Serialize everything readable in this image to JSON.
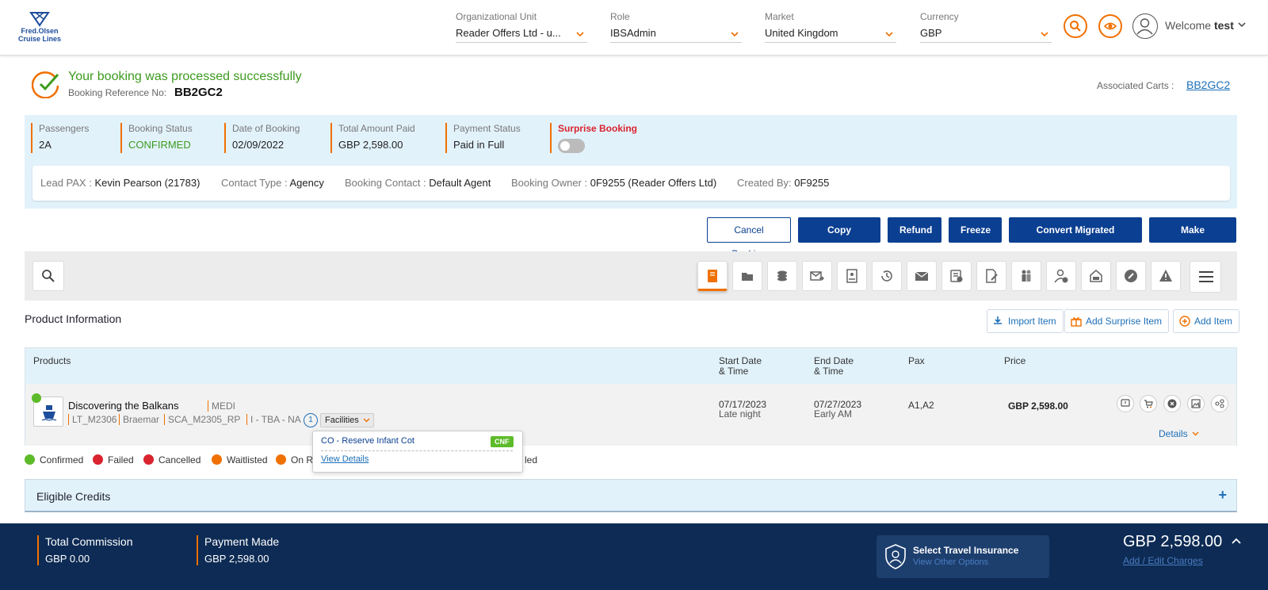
{
  "brand": {
    "line1": "Fred.Olsen",
    "line2": "Cruise Lines"
  },
  "header": {
    "org_unit": {
      "label": "Organizational Unit",
      "value": "Reader Offers Ltd - u..."
    },
    "role": {
      "label": "Role",
      "value": "IBSAdmin"
    },
    "market": {
      "label": "Market",
      "value": "United Kingdom"
    },
    "currency": {
      "label": "Currency",
      "value": "GBP"
    },
    "welcome_prefix": "Welcome",
    "welcome_user": "test"
  },
  "booking": {
    "success_message": "Your booking was processed successfully",
    "ref_label": "Booking Reference No:",
    "ref_value": "BB2GC2",
    "assoc_label": "Associated Carts :",
    "assoc_value": "BB2GC2"
  },
  "summary": {
    "passengers": {
      "label": "Passengers",
      "value": "2A"
    },
    "status": {
      "label": "Booking Status",
      "value": "CONFIRMED"
    },
    "date": {
      "label": "Date of Booking",
      "value": "02/09/2022"
    },
    "paid": {
      "label": "Total Amount Paid",
      "value": "GBP 2,598.00"
    },
    "payment_status": {
      "label": "Payment Status",
      "value": "Paid in Full"
    },
    "surprise": {
      "label": "Surprise Booking",
      "enabled": false
    }
  },
  "contact": {
    "lead_pax": {
      "label": "Lead PAX :",
      "value": "Kevin Pearson (21783)"
    },
    "contact_type": {
      "label": "Contact Type :",
      "value": "Agency"
    },
    "booking_contact": {
      "label": "Booking Contact :",
      "value": "Default Agent"
    },
    "booking_owner": {
      "label": "Booking Owner :",
      "value": "0F9255 (Reader Offers Ltd)"
    },
    "created_by": {
      "label": "Created By:",
      "value": "0F9255"
    }
  },
  "actions": {
    "cancel": "Cancel Booking",
    "copy": "Copy Booking",
    "refund": "Refund",
    "freeze": "Freeze",
    "convert": "Convert Migrated Booking",
    "payment": "Make Payment"
  },
  "product_section": {
    "title": "Product Information",
    "import": "Import Item",
    "add_surprise": "Add Surprise Item",
    "add": "Add Item"
  },
  "table": {
    "headers": {
      "products": "Products",
      "start_1": "Start Date",
      "start_2": "& Time",
      "end_1": "End Date",
      "end_2": "& Time",
      "pax": "Pax",
      "price": "Price"
    },
    "row": {
      "name": "Discovering the Balkans",
      "code": "MEDI",
      "meta1": "LT_M2306",
      "meta2": "Braemar",
      "meta3": "SCA_M2305_RP",
      "meta4": "I - TBA - NA",
      "facility_count": "1",
      "facilities_label": "Facilities",
      "start_date": "07/17/2023",
      "start_time": "Late night",
      "end_date": "07/27/2023",
      "end_time": "Early AM",
      "pax": "A1,A2",
      "price": "GBP 2,598.00",
      "details": "Details"
    }
  },
  "popup": {
    "item": "CO - Reserve Infant Cot",
    "badge": "CNF",
    "link": "View Details"
  },
  "legend": {
    "confirmed": "Confirmed",
    "failed": "Failed",
    "cancelled": "Cancelled",
    "waitlisted": "Waitlisted",
    "on_request": "On R",
    "tail": "led"
  },
  "credits": {
    "title": "Eligible Credits",
    "toggle": "+"
  },
  "footer": {
    "commission": {
      "label": "Total Commission",
      "value": "GBP 0.00"
    },
    "payment_made": {
      "label": "Payment Made",
      "value": "GBP 2,598.00"
    },
    "insurance_title": "Select Travel Insurance",
    "insurance_link": "View Other Options",
    "total": "GBP 2,598.00",
    "edit_link": "Add / Edit Charges"
  },
  "colors": {
    "primary": "#0b3f91",
    "accent": "#f07000",
    "success": "#3c9b1e",
    "panel": "#e2f2fb",
    "footer": "#0d2b54"
  }
}
